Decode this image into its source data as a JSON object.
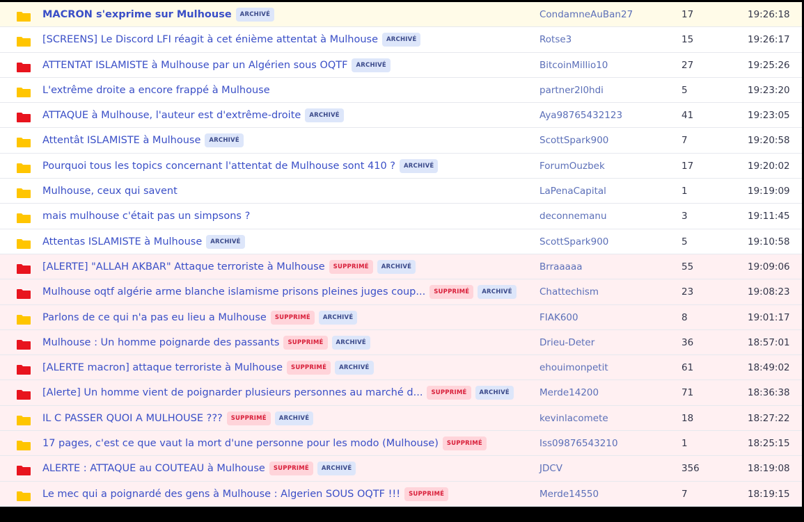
{
  "colors": {
    "folder_yellow": "#ffc500",
    "folder_red": "#e8141e",
    "title_link": "#3a4fc7",
    "author_link": "#5b6fb8",
    "badge_archive_bg": "#dde6fa",
    "badge_deleted_bg": "#ffd4da",
    "row_deleted_bg": "#fff0f2"
  },
  "badge_labels": {
    "archived": "ARCHIVÉ",
    "deleted": "SUPPRIMÉ"
  },
  "topics": [
    {
      "title": "MACRON s'exprime sur Mulhouse",
      "icon": "folder-yellow-icon",
      "deleted": false,
      "archived": true,
      "author": "CondamneAuBan27",
      "replies": "17",
      "time": "19:26:18"
    },
    {
      "title": "[SCREENS] Le Discord LFI réagit à cet énième attentat à Mulhouse",
      "icon": "folder-yellow-icon",
      "deleted": false,
      "archived": true,
      "author": "Rotse3",
      "replies": "15",
      "time": "19:26:17"
    },
    {
      "title": "ATTENTAT ISLAMISTE à Mulhouse par un Algérien sous OQTF",
      "icon": "folder-red-icon",
      "deleted": false,
      "archived": true,
      "author": "BitcoinMillio10",
      "replies": "27",
      "time": "19:25:26"
    },
    {
      "title": "L'extrême droite a encore frappé à Mulhouse",
      "icon": "folder-yellow-icon",
      "deleted": false,
      "archived": false,
      "author": "partner2l0hdi",
      "replies": "5",
      "time": "19:23:20"
    },
    {
      "title": "ATTAQUE à Mulhouse, l'auteur est d'extrême-droite",
      "icon": "folder-red-icon",
      "deleted": false,
      "archived": true,
      "author": "Aya98765432123",
      "replies": "41",
      "time": "19:23:05"
    },
    {
      "title": "Attentât ISLAMISTE à Mulhouse",
      "icon": "folder-yellow-icon",
      "deleted": false,
      "archived": true,
      "author": "ScottSpark900",
      "replies": "7",
      "time": "19:20:58"
    },
    {
      "title": "Pourquoi tous les topics concernant l'attentat de Mulhouse sont 410 ?",
      "icon": "folder-yellow-icon",
      "deleted": false,
      "archived": true,
      "author": "ForumOuzbek",
      "replies": "17",
      "time": "19:20:02"
    },
    {
      "title": "Mulhouse, ceux qui savent",
      "icon": "folder-yellow-icon",
      "deleted": false,
      "archived": false,
      "author": "LaPenaCapital",
      "replies": "1",
      "time": "19:19:09"
    },
    {
      "title": "mais mulhouse c'était pas un simpsons ?",
      "icon": "folder-yellow-icon",
      "deleted": false,
      "archived": false,
      "author": "deconnemanu",
      "replies": "3",
      "time": "19:11:45"
    },
    {
      "title": "Attentas ISLAMISTE à Mulhouse",
      "icon": "folder-yellow-icon",
      "deleted": false,
      "archived": true,
      "author": "ScottSpark900",
      "replies": "5",
      "time": "19:10:58"
    },
    {
      "title": "[ALERTE] \"ALLAH AKBAR\" Attaque terroriste à Mulhouse",
      "icon": "folder-red-icon",
      "deleted": true,
      "archived": true,
      "author": "Brraaaaa",
      "replies": "55",
      "time": "19:09:06"
    },
    {
      "title": "Mulhouse oqtf algérie arme blanche islamisme prisons pleines juges coup...",
      "icon": "folder-red-icon",
      "deleted": true,
      "archived": true,
      "author": "Chattechism",
      "replies": "23",
      "time": "19:08:23"
    },
    {
      "title": "Parlons de ce qui n'a pas eu lieu a Mulhouse",
      "icon": "folder-yellow-icon",
      "deleted": true,
      "archived": true,
      "author": "FIAK600",
      "replies": "8",
      "time": "19:01:17"
    },
    {
      "title": "Mulhouse : Un homme poignarde des passants",
      "icon": "folder-red-icon",
      "deleted": true,
      "archived": true,
      "author": "Drieu-Deter",
      "replies": "36",
      "time": "18:57:01"
    },
    {
      "title": "[ALERTE macron] attaque terroriste à Mulhouse",
      "icon": "folder-red-icon",
      "deleted": true,
      "archived": true,
      "author": "ehouimonpetit",
      "replies": "61",
      "time": "18:49:02"
    },
    {
      "title": "[Alerte] Un homme vient de poignarder plusieurs personnes au marché d...",
      "icon": "folder-red-icon",
      "deleted": true,
      "archived": true,
      "author": "Merde14200",
      "replies": "71",
      "time": "18:36:38"
    },
    {
      "title": "IL C PASSER QUOI A MULHOUSE ???",
      "icon": "folder-yellow-icon",
      "deleted": true,
      "archived": true,
      "author": "kevinlacomete",
      "replies": "18",
      "time": "18:27:22"
    },
    {
      "title": "17 pages, c'est ce que vaut la mort d'une personne pour les modo (Mulhouse)",
      "icon": "folder-yellow-icon",
      "deleted": true,
      "archived": false,
      "author": "Iss09876543210",
      "replies": "1",
      "time": "18:25:15"
    },
    {
      "title": "ALERTE : ATTAQUE au COUTEAU à Mulhouse",
      "icon": "folder-red-icon",
      "deleted": true,
      "archived": true,
      "author": "JDCV",
      "replies": "356",
      "time": "18:19:08"
    },
    {
      "title": "Le mec qui a poignardé des gens à Mulhouse : Algerien SOUS OQTF !!!",
      "icon": "folder-yellow-icon",
      "deleted": true,
      "archived": false,
      "author": "Merde14550",
      "replies": "7",
      "time": "18:19:15"
    }
  ]
}
